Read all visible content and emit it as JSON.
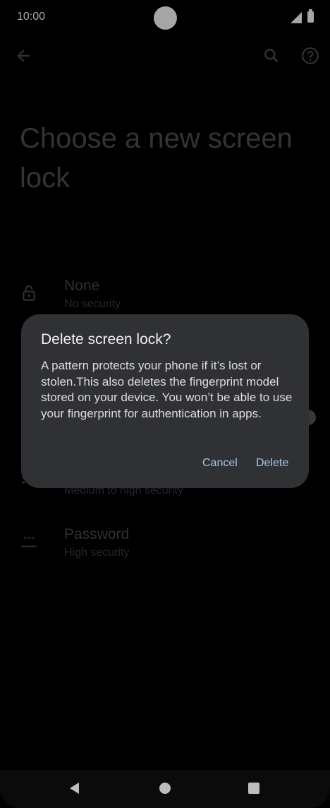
{
  "status_bar": {
    "time": "10:00"
  },
  "app_bar": {
    "back_icon": "arrow-back-icon",
    "search_icon": "search-icon",
    "help_icon": "help-icon"
  },
  "page": {
    "title": "Choose a new screen lock"
  },
  "options": [
    {
      "title": "None",
      "subtitle": "No security",
      "icon": "lock-open-icon"
    },
    {
      "title": "",
      "subtitle": "Medium to high security",
      "icon": "pin-icon"
    },
    {
      "title": "Password",
      "subtitle": "High security",
      "icon": "password-icon"
    }
  ],
  "dialog": {
    "title": "Delete screen lock?",
    "body": "A pattern protects your phone if it’s lost or stolen.This also deletes the fingerprint model stored on your device. You won’t be able to use your fingerprint for authentication in apps.",
    "cancel_label": "Cancel",
    "delete_label": "Delete"
  },
  "colors": {
    "dialog_bg": "#2f3134",
    "button_text": "#a9c7e8"
  }
}
